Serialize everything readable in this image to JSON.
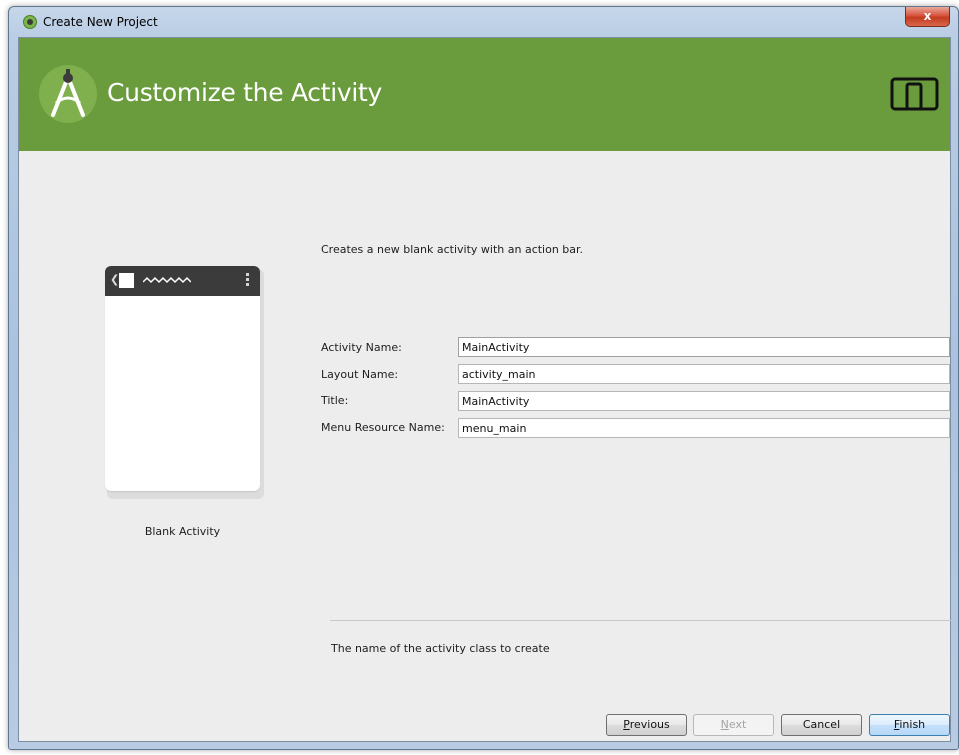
{
  "window": {
    "title": "Create New Project",
    "close_label": "x"
  },
  "header": {
    "title": "Customize the Activity",
    "background": "#6a9c3d"
  },
  "preview": {
    "label": "Blank Activity"
  },
  "description": "Creates a new blank activity with an action bar.",
  "form": {
    "activity_name_label": "Activity Name:",
    "activity_name_value": "MainActivity",
    "layout_name_label": "Layout Name:",
    "layout_name_value": "activity_main",
    "title_label": "Title:",
    "title_value": "MainActivity",
    "menu_resource_label": "Menu Resource Name:",
    "menu_resource_value": "menu_main"
  },
  "hint": "The name of the activity class to create",
  "buttons": {
    "previous_mnemonic": "P",
    "previous_rest": "revious",
    "next_mnemonic": "N",
    "next_rest": "ext",
    "cancel": "Cancel",
    "finish_mnemonic": "F",
    "finish_rest": "inish"
  },
  "icons": {
    "app": "android-studio-icon",
    "header_logo": "android-studio-logo",
    "device": "tablet-phone-icon",
    "close": "close-icon"
  }
}
